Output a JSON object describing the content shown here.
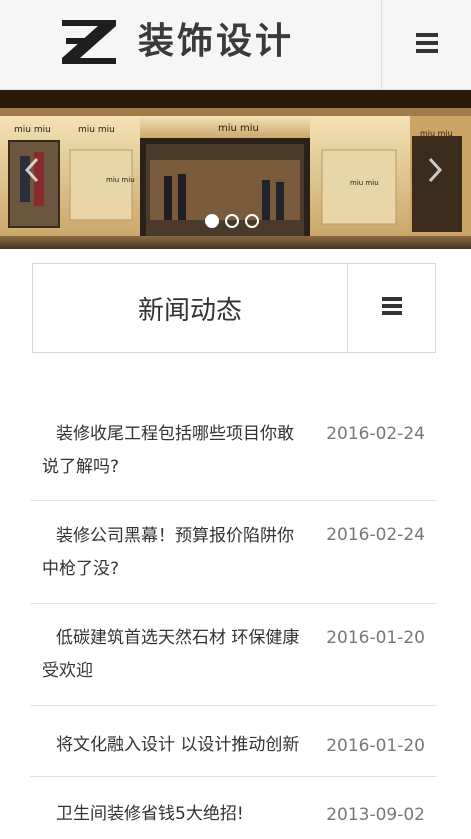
{
  "header": {
    "logo_text": "装饰设计",
    "icons": {
      "menu": "hamburger-menu-icon",
      "logo": "z-logo-icon"
    }
  },
  "banner": {
    "brand_signs": [
      "miu miu",
      "miu miu",
      "miu miu",
      "miu miu",
      "miu miu",
      "miu miu"
    ],
    "slide_count": 3,
    "active_slide": 1,
    "icons": {
      "prev": "chevron-left-icon",
      "next": "chevron-right-icon"
    }
  },
  "section": {
    "title": "新闻动态",
    "icons": {
      "menu": "hamburger-menu-icon"
    }
  },
  "news": [
    {
      "title": "装修收尾工程包括哪些项目你敢说了解吗?",
      "date": "2016-02-24"
    },
    {
      "title": "装修公司黑幕！预算报价陷阱你中枪了没?",
      "date": "2016-02-24"
    },
    {
      "title": "低碳建筑首选天然石材 环保健康受欢迎",
      "date": "2016-01-20"
    },
    {
      "title": "将文化融入设计 以设计推动创新",
      "date": "2016-01-20"
    },
    {
      "title": "卫生间装修省钱5大绝招!",
      "date": "2013-09-02"
    }
  ],
  "colors": {
    "header_bg": "#f6f6f6",
    "logo_text": "#3a3a3a",
    "date_text": "#777777",
    "divider": "#e3e3e3"
  }
}
